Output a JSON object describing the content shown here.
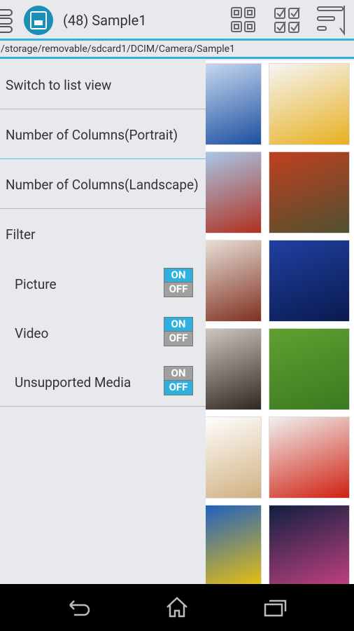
{
  "header": {
    "title": "(48) Sample1",
    "path": "/storage/removable/sdcard1/DCIM/Camera/Sample1"
  },
  "menu": {
    "switch_view": "Switch to list view",
    "columns_portrait": "Number of Columns(Portrait)",
    "columns_landscape": "Number of Columns(Landscape)",
    "filter": "Filter",
    "filters": [
      {
        "label": "Picture",
        "on": true
      },
      {
        "label": "Video",
        "on": true
      },
      {
        "label": "Unsupported Media",
        "on": false
      }
    ],
    "on_label": "ON",
    "off_label": "OFF"
  },
  "colors": {
    "accent": "#2fb0e0",
    "toggle_off": "#a0a0a0"
  },
  "thumbnails": [
    {
      "name": "mountain-lake",
      "c": [
        "#c8d8f0",
        "#1c4fa0"
      ]
    },
    {
      "name": "beer-glass",
      "c": [
        "#f5f5f5",
        "#e8b020"
      ]
    },
    {
      "name": "temple",
      "c": [
        "#a8c8e8",
        "#b03020"
      ]
    },
    {
      "name": "autumn-tree",
      "c": [
        "#c04020",
        "#505030"
      ]
    },
    {
      "name": "flowers-cafe",
      "c": [
        "#e8e0d8",
        "#803020"
      ]
    },
    {
      "name": "night-sea",
      "c": [
        "#2040a0",
        "#0a1a50"
      ]
    },
    {
      "name": "dog-closeup",
      "c": [
        "#d0c8c0",
        "#302820"
      ]
    },
    {
      "name": "dog-grass",
      "c": [
        "#60a030",
        "#3a7a20"
      ]
    },
    {
      "name": "coffee-cake",
      "c": [
        "#ffffff",
        "#d0b080"
      ]
    },
    {
      "name": "red-leaves",
      "c": [
        "#f0f0f0",
        "#d02010"
      ]
    },
    {
      "name": "sunflower",
      "c": [
        "#2060c0",
        "#e8c010"
      ]
    },
    {
      "name": "fireworks",
      "c": [
        "#102040",
        "#c04080"
      ]
    }
  ]
}
